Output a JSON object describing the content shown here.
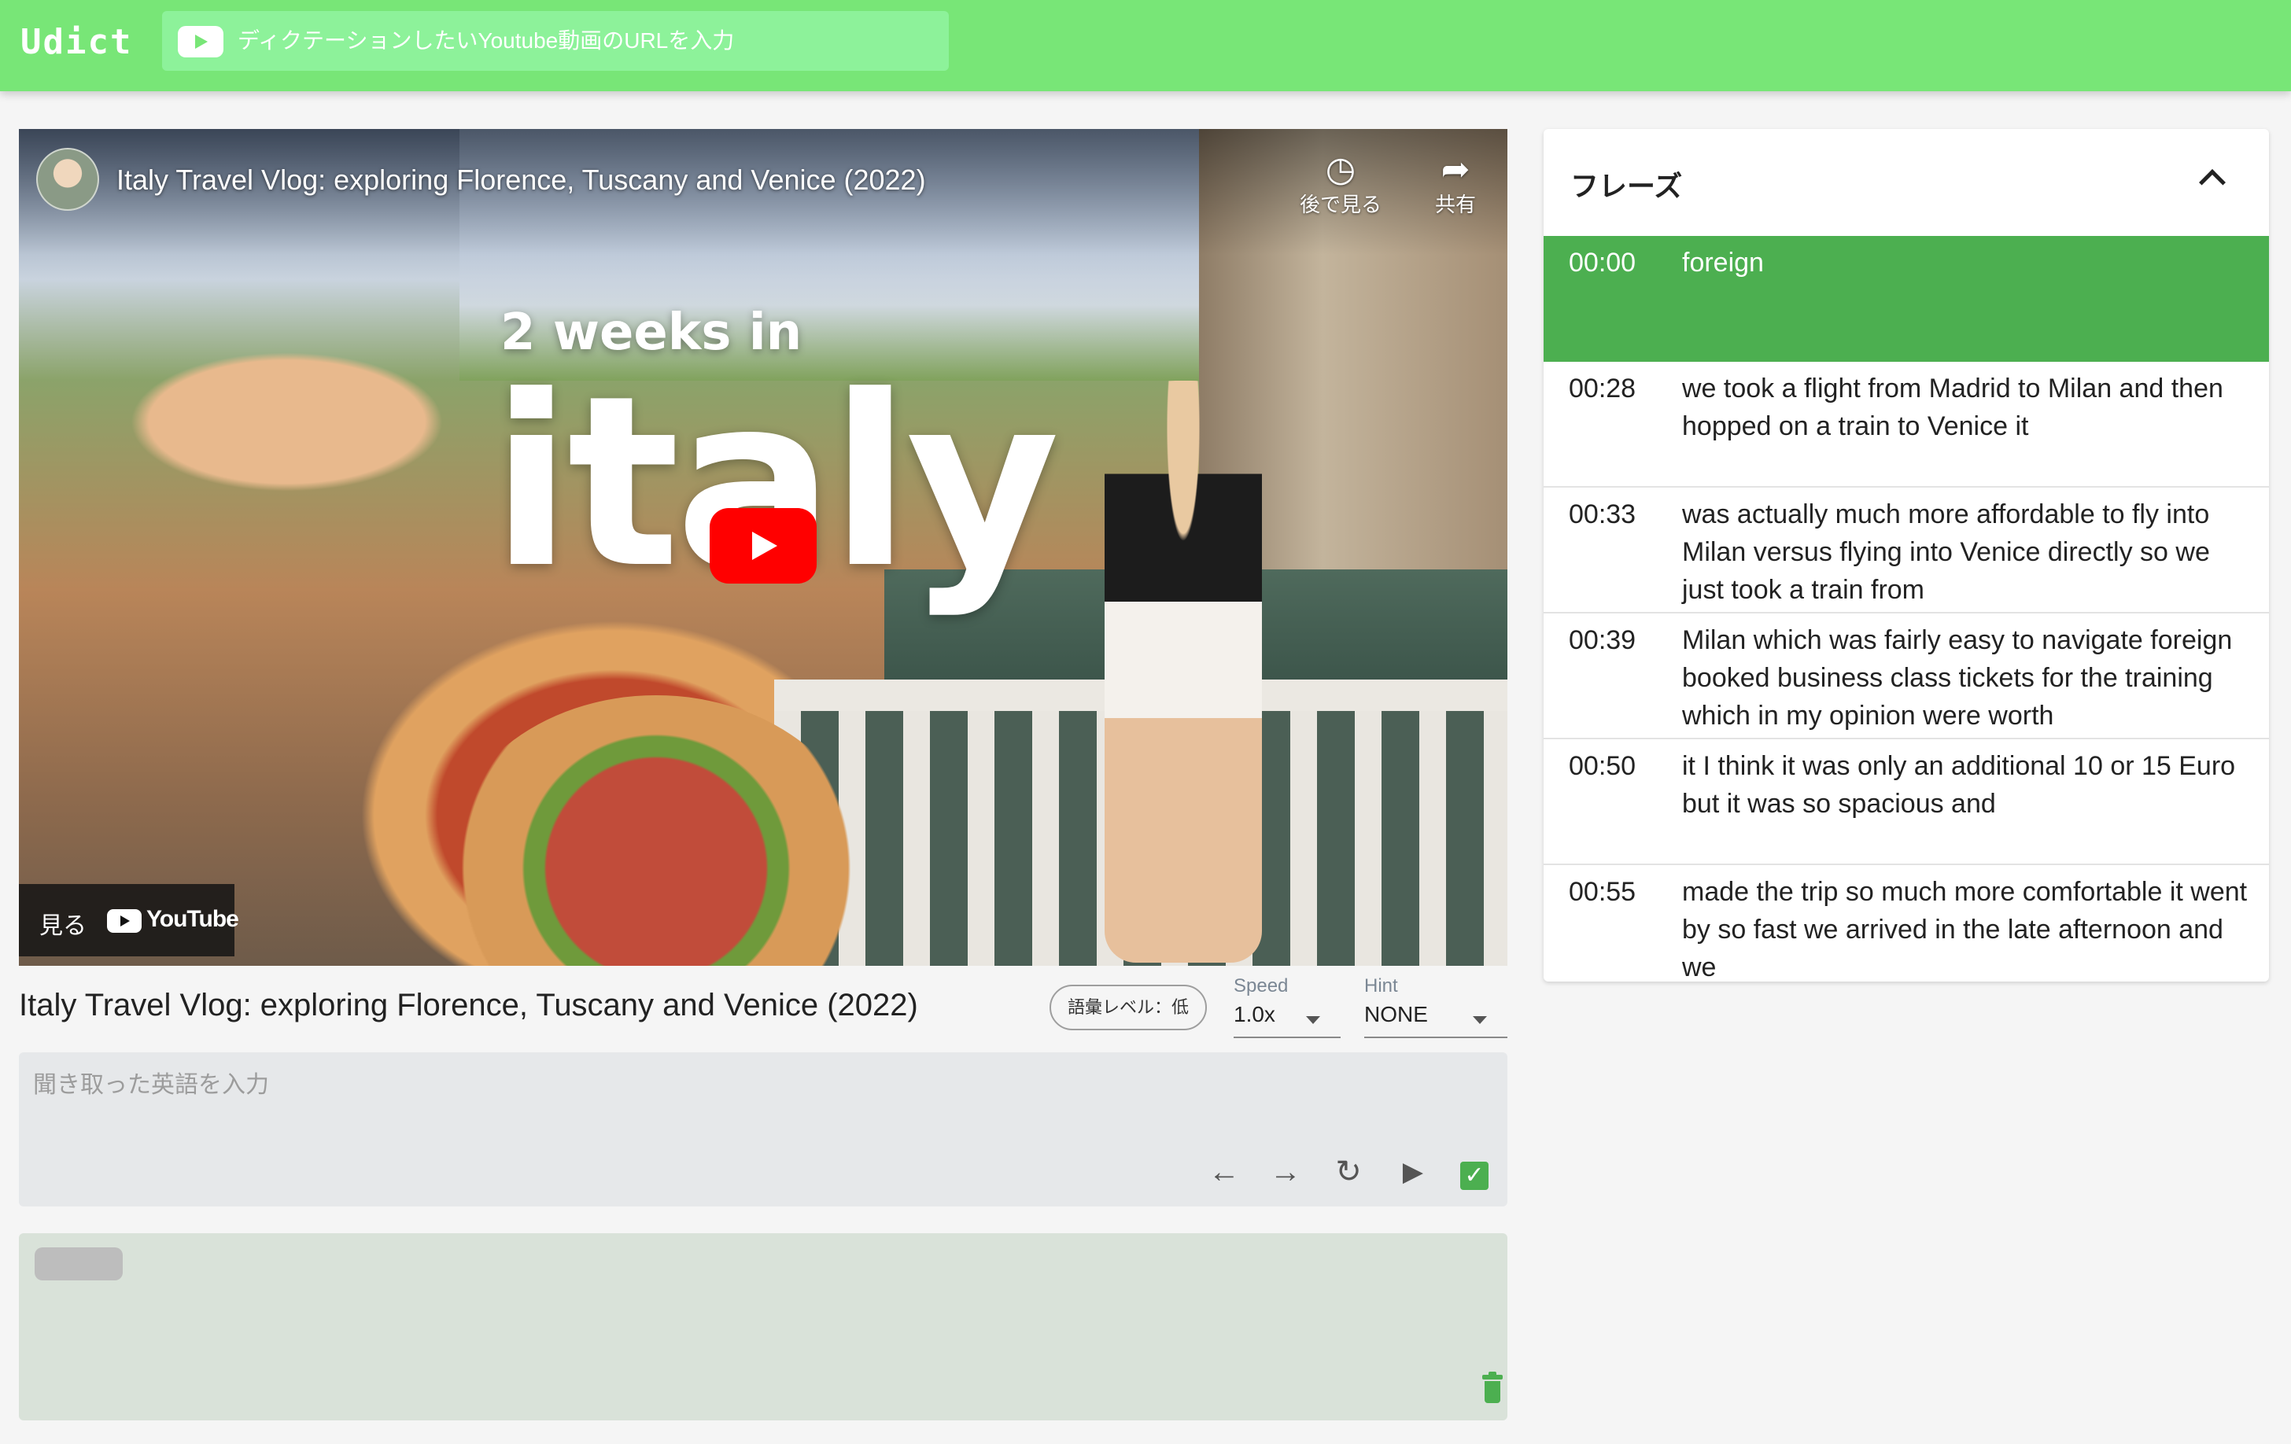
{
  "app": {
    "logo": "Udict",
    "url_placeholder": "ディクテーションしたいYoutube動画のURLを入力"
  },
  "player": {
    "title": "Italy Travel Vlog: exploring Florence, Tuscany and Venice (2022)",
    "overlay_small": "2 weeks in",
    "overlay_big": "italy",
    "watch_later": "後で見る",
    "share": "共有",
    "watch_on": "見る",
    "youtube": "YouTube",
    "play_icon": "play-icon"
  },
  "controls": {
    "video_title": "Italy Travel Vlog: exploring Florence, Tuscany and Venice (2022)",
    "vocab_level": "語彙レベル：低",
    "speed": {
      "label": "Speed",
      "value": "1.0x"
    },
    "hint": {
      "label": "Hint",
      "value": "NONE"
    }
  },
  "answer": {
    "placeholder": "聞き取った英語を入力",
    "icons": [
      "arrow-left-icon",
      "arrow-right-icon",
      "replay-icon",
      "play-icon",
      "check-icon"
    ]
  },
  "history": {
    "icons": [
      "trash-icon"
    ]
  },
  "phrases": {
    "title": "フレーズ",
    "items": [
      {
        "time": "00:00",
        "text": "foreign",
        "active": true
      },
      {
        "time": "00:28",
        "text": "we took a flight from Madrid to Milan and then hopped on a train to Venice it",
        "active": false
      },
      {
        "time": "00:33",
        "text": "was actually much more affordable to fly into Milan versus flying into Venice directly so we just took a train from",
        "active": false
      },
      {
        "time": "00:39",
        "text": "Milan which was fairly easy to navigate foreign booked business class tickets for the training which in my opinion were worth",
        "active": false
      },
      {
        "time": "00:50",
        "text": "it I think it was only an additional 10 or 15 Euro but it was so spacious and",
        "active": false
      },
      {
        "time": "00:55",
        "text": "made the trip so much more comfortable it went by so fast we arrived in the late afternoon and we",
        "active": false
      }
    ]
  },
  "colors": {
    "appbar": "#78e677",
    "url_box": "#8df29a",
    "active_phrase": "#4caf50",
    "youtube_red": "#ff0000"
  }
}
